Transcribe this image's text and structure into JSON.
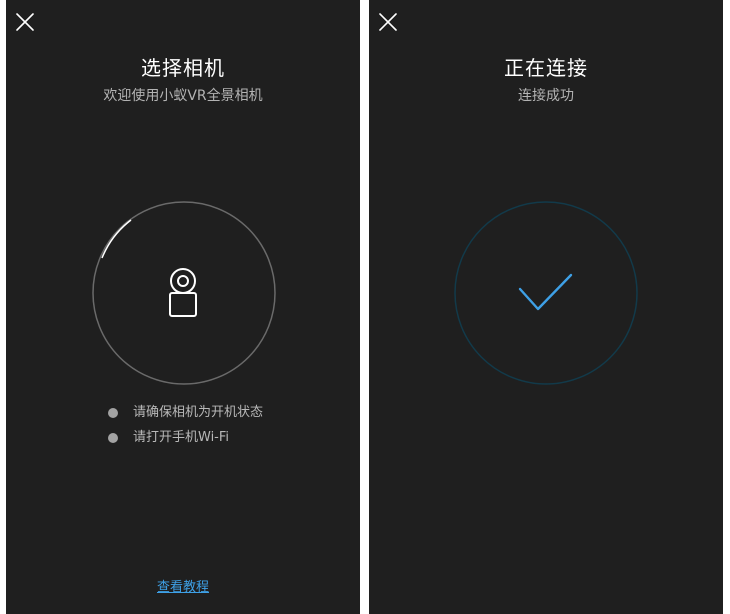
{
  "colors": {
    "background": "#1f1f1f",
    "title": "#ffffff",
    "subtitle": "#b3b3b3",
    "accent": "#3ea0e6",
    "success_ring": "#123a4a"
  },
  "select_screen": {
    "close_icon": "close-icon",
    "title": "选择相机",
    "subtitle": "欢迎使用小蚁VR全景相机",
    "camera_icon": "camera-icon",
    "hints": [
      "请确保相机为开机状态",
      "请打开手机Wi-Fi"
    ],
    "tutorial_link": "查看教程"
  },
  "connect_screen": {
    "close_icon": "close-icon",
    "title": "正在连接",
    "subtitle": "连接成功",
    "status_icon": "checkmark-icon"
  }
}
